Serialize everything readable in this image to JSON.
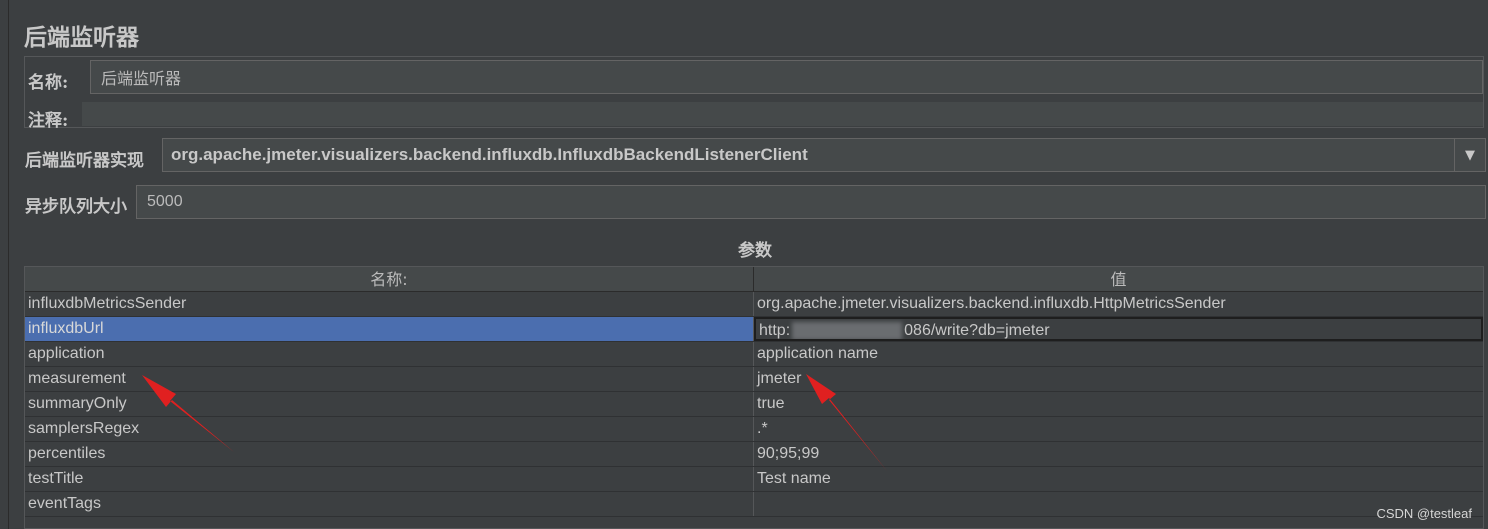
{
  "panel": {
    "title": "后端监听器"
  },
  "name_field": {
    "label": "名称:",
    "value": "后端监听器"
  },
  "comment_field": {
    "label": "注释:",
    "value": ""
  },
  "implementation": {
    "label": "后端监听器实现",
    "value": "org.apache.jmeter.visualizers.backend.influxdb.InfluxdbBackendListenerClient",
    "dropdown_icon": "triangle-down"
  },
  "queue_size": {
    "label": "异步队列大小",
    "value": "5000"
  },
  "parameters": {
    "title": "参数",
    "columns": [
      "名称:",
      "值"
    ],
    "rows": [
      {
        "name": "influxdbMetricsSender",
        "value": "org.apache.jmeter.visualizers.backend.influxdb.HttpMetricsSender"
      },
      {
        "name": "influxdbUrl",
        "value_prefix": "http:",
        "value_suffix": "086/write?db=jmeter"
      },
      {
        "name": "application",
        "value": "application name"
      },
      {
        "name": "measurement",
        "value": "jmeter"
      },
      {
        "name": "summaryOnly",
        "value": "true"
      },
      {
        "name": "samplersRegex",
        "value": ".*"
      },
      {
        "name": "percentiles",
        "value": "90;95;99"
      },
      {
        "name": "testTitle",
        "value": "Test name"
      },
      {
        "name": "eventTags",
        "value": ""
      }
    ]
  },
  "annotation_color": "#e02020",
  "watermark": "CSDN @testleaf"
}
